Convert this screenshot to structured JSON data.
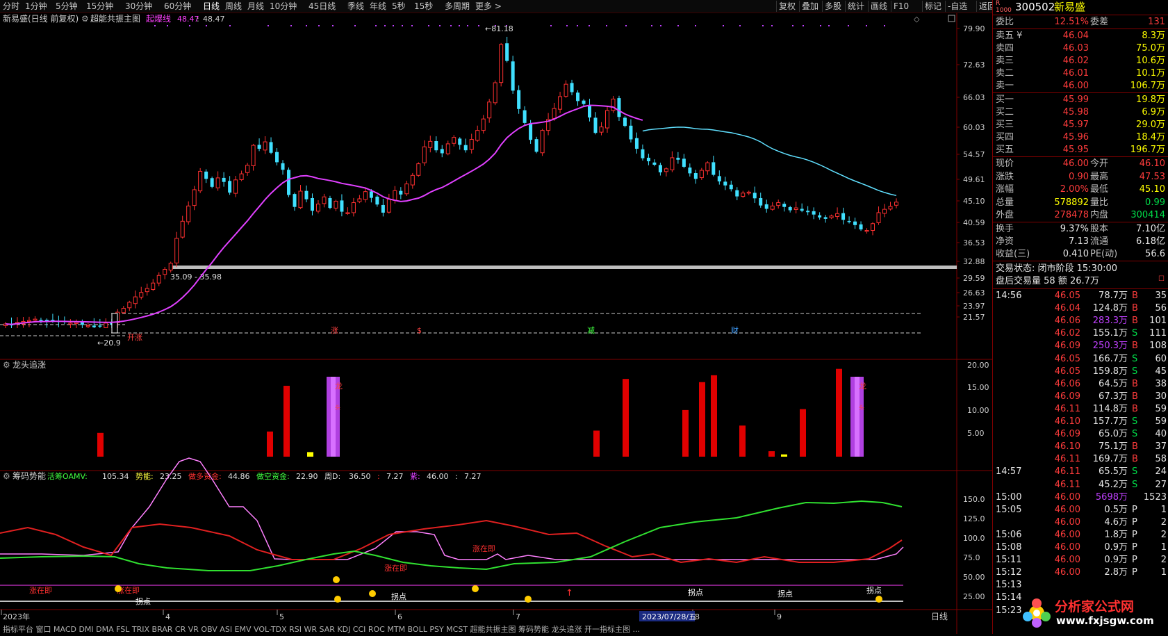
{
  "toolbar": {
    "periods": [
      "分时",
      "1分钟",
      "5分钟",
      "15分钟",
      "30分钟",
      "60分钟",
      "日线",
      "周线",
      "月线",
      "10分钟",
      "45日线",
      "季线",
      "年线",
      "5秒",
      "15秒",
      "多周期",
      "更多 >"
    ],
    "active_period": "日线",
    "right_tools": [
      "复权",
      "叠加",
      "多股",
      "统计",
      "画线",
      "F10",
      "标记",
      "-自选",
      "返回"
    ]
  },
  "main_chart": {
    "title": "新易盛(日线 前复权)",
    "indicator_name": "超能共振主图",
    "indicator_line_label": "起爆线",
    "indicator_value_1": "48.47",
    "indicator_value_2": "48.47",
    "high_marker": "81.18",
    "low_marker": "20.9",
    "range_label": "35.09 - 35.98",
    "price_axis": [
      "79.90",
      "72.63",
      "66.03",
      "60.03",
      "54.57",
      "49.61",
      "45.10",
      "40.59",
      "36.53",
      "32.88",
      "29.59",
      "26.63",
      "23.97",
      "21.57"
    ],
    "event_marks": [
      {
        "text": "涨",
        "color": "#ff4040"
      },
      {
        "text": "$",
        "color": "#ff4040"
      },
      {
        "text": "减",
        "color": "#40ff40"
      },
      {
        "text": "财",
        "color": "#40a0ff"
      }
    ],
    "signal_text": "开涨"
  },
  "panel2": {
    "name": "龙头追涨",
    "axis": [
      "20.00",
      "15.00",
      "10.00",
      "5.00"
    ],
    "dragon_label": "龙",
    "dragon_label_2": "头"
  },
  "panel3": {
    "name": "筹码势能",
    "legend": [
      {
        "label": "活筹OAMV:",
        "value": "105.34",
        "color": "#40ff40"
      },
      {
        "label": "势能:",
        "value": "23.25",
        "color": "#ffff40"
      },
      {
        "label": "做多资金:",
        "value": "44.86",
        "color": "#ff3030"
      },
      {
        "label": "做空资金:",
        "value": "22.90",
        "color": "#40ff40"
      },
      {
        "label": "周D:",
        "value": "36.50",
        "color": "#e0e0e0"
      },
      {
        "label": ":",
        "value": "7.27",
        "color": "#ff3030"
      },
      {
        "label": "紫:",
        "value": "46.00",
        "color": "#e040ff"
      },
      {
        "label": ":",
        "value": "7.27",
        "color": "#e0e0e0"
      }
    ],
    "axis": [
      "150.0",
      "125.0",
      "100.0",
      "75.0",
      "50.00",
      "25.00"
    ],
    "annotations": [
      "涨在即",
      "涨在即",
      "拐点",
      "涨在即",
      "涨在即",
      "拐点",
      "拐点",
      "拐点",
      "拐点"
    ]
  },
  "date_axis": {
    "labels": [
      "2023年",
      "4",
      "5",
      "6",
      "7",
      "8",
      "9"
    ],
    "highlight": "2023/07/28/五",
    "period": "日线"
  },
  "bottom_tabs": "指标平台  窗口  MACD  DMI  DMA  FSL  TRIX  BRAR  CR  VR  OBV  ASI  EMV  VOL-TDX  RSI  WR  SAR  KDJ  CCI  ROC  MTM  BOLL  PSY  MCST  超能共振主图  筹码势能  龙头追涨  开一指标主图  ...",
  "quote": {
    "code": "300502",
    "name": "新易盛",
    "weibi_label": "委比",
    "weibi": "12.51%",
    "weicha_label": "委差",
    "weicha": "131",
    "asks": [
      {
        "label": "卖五",
        "mark": "¥",
        "price": "46.04",
        "vol": "8.3万"
      },
      {
        "label": "卖四",
        "mark": "",
        "price": "46.03",
        "vol": "75.0万"
      },
      {
        "label": "卖三",
        "mark": "",
        "price": "46.02",
        "vol": "10.6万"
      },
      {
        "label": "卖二",
        "mark": "",
        "price": "46.01",
        "vol": "10.1万"
      },
      {
        "label": "卖一",
        "mark": "",
        "price": "46.00",
        "vol": "106.7万"
      }
    ],
    "bids": [
      {
        "label": "买一",
        "price": "45.99",
        "vol": "19.8万"
      },
      {
        "label": "买二",
        "price": "45.98",
        "vol": "6.9万"
      },
      {
        "label": "买三",
        "price": "45.97",
        "vol": "29.0万"
      },
      {
        "label": "买四",
        "price": "45.96",
        "vol": "18.4万"
      },
      {
        "label": "买五",
        "price": "45.95",
        "vol": "196.7万"
      }
    ],
    "stats": [
      {
        "l1": "现价",
        "v1": "46.00",
        "c1": "red",
        "l2": "今开",
        "v2": "46.10",
        "c2": "red"
      },
      {
        "l1": "涨跌",
        "v1": "0.90",
        "c1": "red",
        "l2": "最高",
        "v2": "47.53",
        "c2": "red"
      },
      {
        "l1": "涨幅",
        "v1": "2.00%",
        "c1": "red",
        "l2": "最低",
        "v2": "45.10",
        "c2": "yellow"
      },
      {
        "l1": "总量",
        "v1": "578892",
        "c1": "yellow",
        "l2": "量比",
        "v2": "0.99",
        "c2": "green"
      },
      {
        "l1": "外盘",
        "v1": "278478",
        "c1": "red",
        "l2": "内盘",
        "v2": "300414",
        "c2": "green"
      }
    ],
    "stats2": [
      {
        "l1": "换手",
        "v1": "9.37%",
        "l2": "股本",
        "v2": "7.10亿"
      },
      {
        "l1": "净资",
        "v1": "7.13",
        "l2": "流通",
        "v2": "6.18亿"
      },
      {
        "l1": "收益(三)",
        "v1": "0.410",
        "l2": "PE(动)",
        "v2": "56.6"
      }
    ],
    "trade_status": "交易状态: 闭市阶段 15:30:00",
    "after_hours": "盘后交易量 58 额 26.7万"
  },
  "ticks": [
    {
      "time": "14:56",
      "price": "46.05",
      "vol": "78.7万",
      "side": "B",
      "n": "35",
      "pc": "red",
      "vc": "white"
    },
    {
      "time": "",
      "price": "46.04",
      "vol": "124.8万",
      "side": "B",
      "n": "56",
      "pc": "red",
      "vc": "white"
    },
    {
      "time": "",
      "price": "46.06",
      "vol": "283.3万",
      "side": "B",
      "n": "101",
      "pc": "red",
      "vc": "purple"
    },
    {
      "time": "",
      "price": "46.02",
      "vol": "155.1万",
      "side": "S",
      "n": "111",
      "pc": "red",
      "vc": "white"
    },
    {
      "time": "",
      "price": "46.09",
      "vol": "250.3万",
      "side": "B",
      "n": "108",
      "pc": "red",
      "vc": "purple"
    },
    {
      "time": "",
      "price": "46.05",
      "vol": "166.7万",
      "side": "S",
      "n": "60",
      "pc": "red",
      "vc": "white"
    },
    {
      "time": "",
      "price": "46.05",
      "vol": "159.8万",
      "side": "S",
      "n": "45",
      "pc": "red",
      "vc": "white"
    },
    {
      "time": "",
      "price": "46.06",
      "vol": "64.5万",
      "side": "B",
      "n": "38",
      "pc": "red",
      "vc": "white"
    },
    {
      "time": "",
      "price": "46.09",
      "vol": "67.3万",
      "side": "B",
      "n": "30",
      "pc": "red",
      "vc": "white"
    },
    {
      "time": "",
      "price": "46.11",
      "vol": "114.8万",
      "side": "B",
      "n": "59",
      "pc": "red",
      "vc": "white"
    },
    {
      "time": "",
      "price": "46.10",
      "vol": "157.7万",
      "side": "S",
      "n": "59",
      "pc": "red",
      "vc": "white"
    },
    {
      "time": "",
      "price": "46.09",
      "vol": "65.0万",
      "side": "S",
      "n": "40",
      "pc": "red",
      "vc": "white"
    },
    {
      "time": "",
      "price": "46.10",
      "vol": "75.1万",
      "side": "B",
      "n": "37",
      "pc": "red",
      "vc": "white"
    },
    {
      "time": "",
      "price": "46.11",
      "vol": "169.7万",
      "side": "B",
      "n": "58",
      "pc": "red",
      "vc": "white"
    },
    {
      "time": "14:57",
      "price": "46.11",
      "vol": "65.5万",
      "side": "S",
      "n": "24",
      "pc": "red",
      "vc": "white"
    },
    {
      "time": "",
      "price": "46.11",
      "vol": "45.2万",
      "side": "S",
      "n": "27",
      "pc": "red",
      "vc": "white"
    },
    {
      "time": "15:00",
      "price": "46.00",
      "vol": "5698万",
      "side": "",
      "n": "1523",
      "pc": "red",
      "vc": "purple"
    },
    {
      "time": "15:05",
      "price": "46.00",
      "vol": "0.5万",
      "side": "P",
      "n": "1",
      "pc": "red",
      "vc": "white"
    },
    {
      "time": "",
      "price": "46.00",
      "vol": "4.6万",
      "side": "P",
      "n": "2",
      "pc": "red",
      "vc": "white"
    },
    {
      "time": "15:06",
      "price": "46.00",
      "vol": "1.8万",
      "side": "P",
      "n": "2",
      "pc": "red",
      "vc": "white"
    },
    {
      "time": "15:08",
      "price": "46.00",
      "vol": "0.9万",
      "side": "P",
      "n": "1",
      "pc": "red",
      "vc": "white"
    },
    {
      "time": "15:11",
      "price": "46.00",
      "vol": "0.9万",
      "side": "P",
      "n": "2",
      "pc": "red",
      "vc": "white"
    },
    {
      "time": "15:12",
      "price": "46.00",
      "vol": "2.8万",
      "side": "P",
      "n": "1",
      "pc": "red",
      "vc": "white"
    },
    {
      "time": "15:13",
      "price": "",
      "vol": "",
      "side": "",
      "n": "",
      "pc": "red",
      "vc": "white"
    },
    {
      "time": "15:14",
      "price": "",
      "vol": "",
      "side": "",
      "n": "",
      "pc": "red",
      "vc": "white"
    },
    {
      "time": "15:23",
      "price": "",
      "vol": "",
      "side": "",
      "n": "",
      "pc": "red",
      "vc": "white"
    }
  ],
  "watermark": {
    "line1": "分析家公式网",
    "line2": "www.fxjsgw.com"
  }
}
